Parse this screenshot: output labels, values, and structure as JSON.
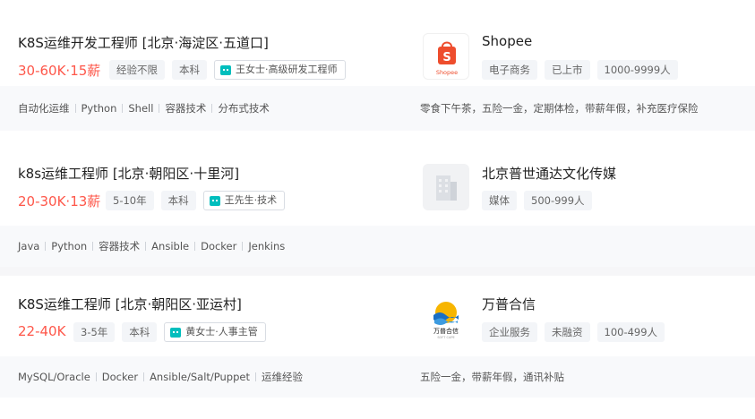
{
  "jobs": [
    {
      "title": "K8S运维开发工程师 [北京·海淀区·五道口]",
      "salary": "30-60K·15薪",
      "tags": [
        "经验不限",
        "本科"
      ],
      "recruiter": "王女士·高级研发工程师",
      "company": {
        "name": "Shopee",
        "logo_text": "Shopee",
        "logo_icon": "shopee-bag-logo",
        "tags": [
          "电子商务",
          "已上市",
          "1000-9999人"
        ]
      },
      "skills": [
        "自动化运维",
        "Python",
        "Shell",
        "容器技术",
        "分布式技术"
      ],
      "benefits": "零食下午茶，五险一金，定期体检，带薪年假，补充医疗保险"
    },
    {
      "title": "k8s运维工程师 [北京·朝阳区·十里河]",
      "salary": "20-30K·13薪",
      "tags": [
        "5-10年",
        "本科"
      ],
      "recruiter": "王先生·技术",
      "company": {
        "name": "北京普世通达文化传媒",
        "logo_icon": "building-placeholder-logo",
        "tags": [
          "媒体",
          "500-999人"
        ]
      },
      "skills": [
        "Java",
        "Python",
        "容器技术",
        "Ansible",
        "Docker",
        "Jenkins"
      ],
      "benefits": ""
    },
    {
      "title": "K8S运维工程师 [北京·朝阳区·亚运村]",
      "salary": "22-40K",
      "tags": [
        "3-5年",
        "本科"
      ],
      "recruiter": "黄女士·人事主管",
      "company": {
        "name": "万普合信",
        "logo_text": "万普合信",
        "logo_subtext": "SOFT CAPE",
        "logo_icon": "wanpu-sun-wave-logo",
        "tags": [
          "企业服务",
          "未融资",
          "100-499人"
        ]
      },
      "skills": [
        "MySQL/Oracle",
        "Docker",
        "Ansible/Salt/Puppet",
        "运维经验"
      ],
      "benefits": "五险一金，带薪年假，通讯补贴"
    }
  ],
  "colors": {
    "salary": "#fe574a",
    "accent": "#00bebd",
    "shopee": "#ee4d2d"
  }
}
